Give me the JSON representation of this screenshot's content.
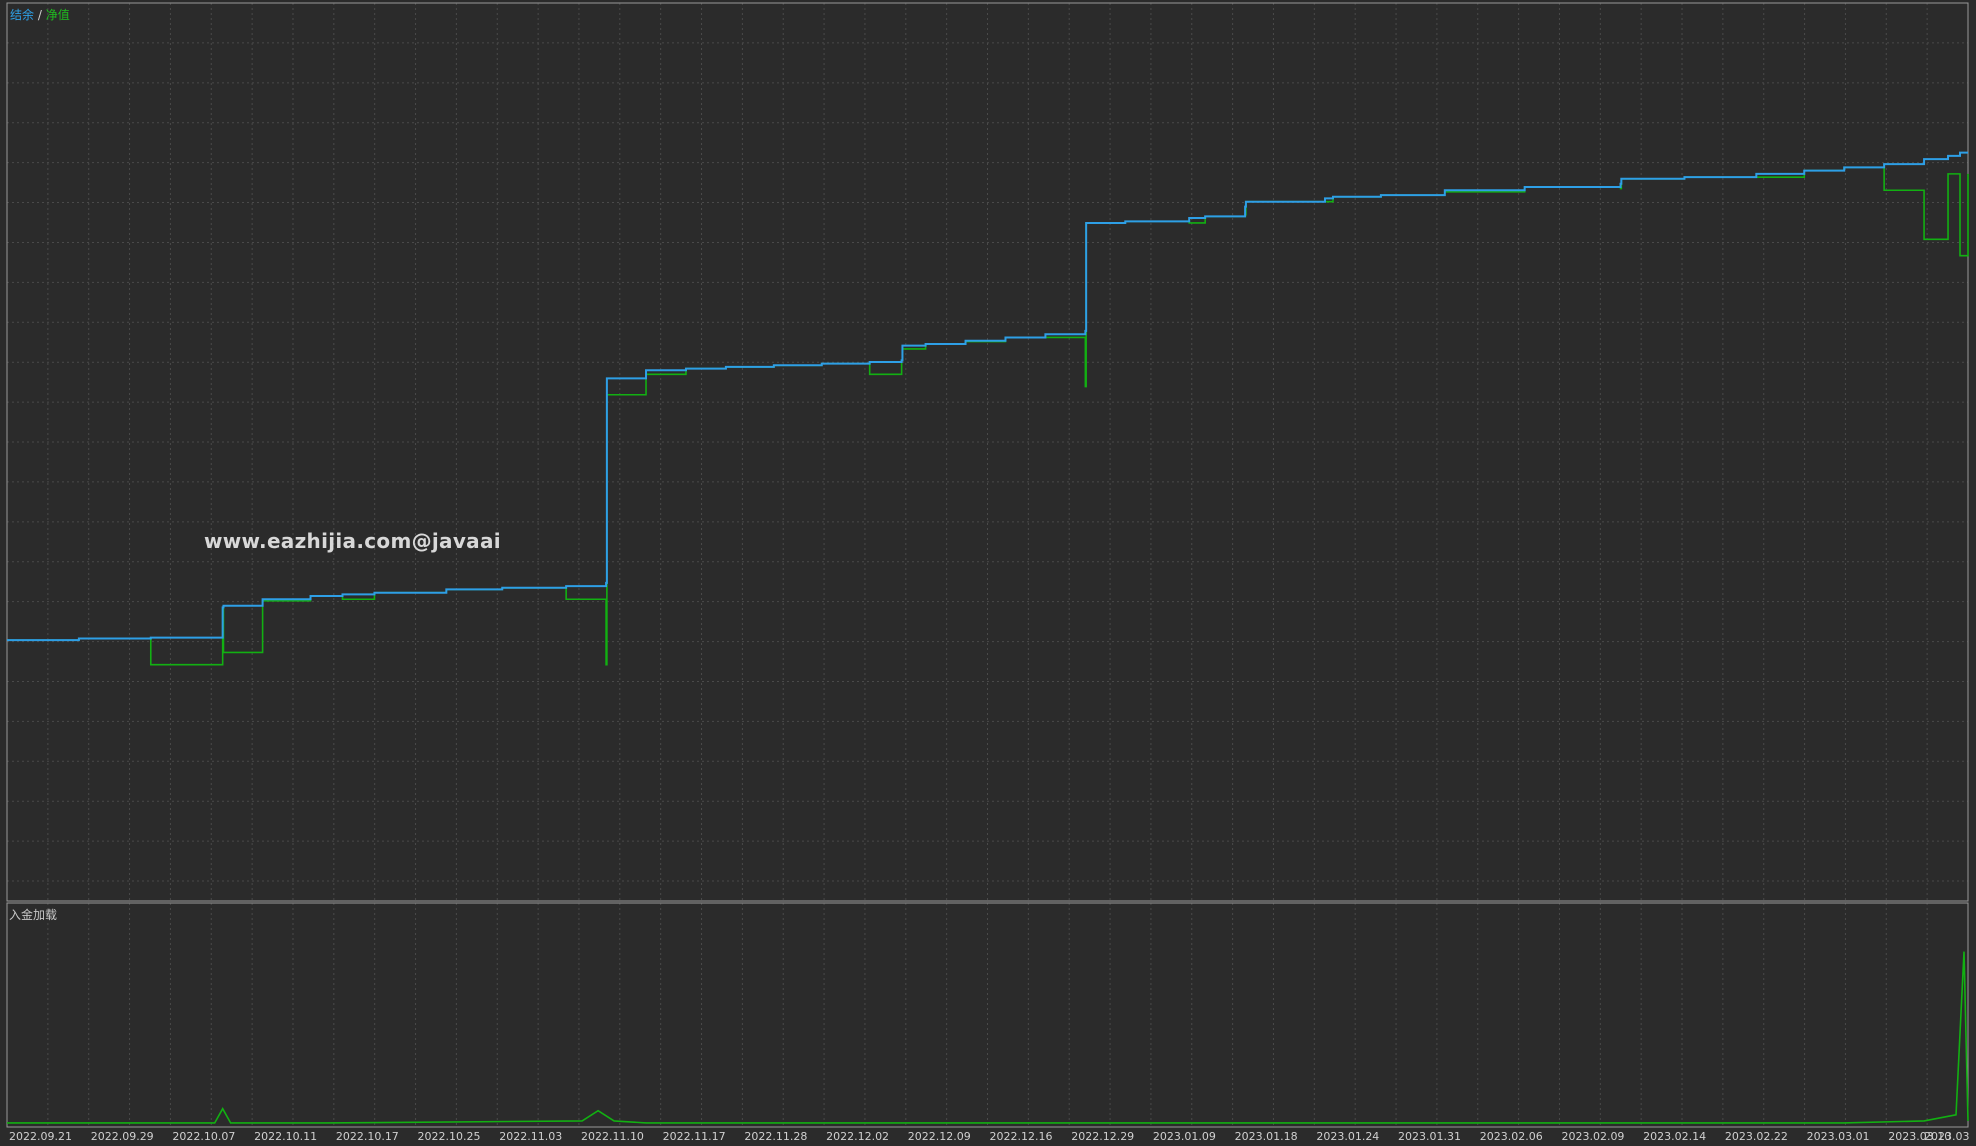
{
  "legend": {
    "balance": "结余",
    "separator": "/",
    "equity": "净值"
  },
  "watermark": "www.eazhijia.com@javaai",
  "subpanel": {
    "label": "入金加载"
  },
  "colors": {
    "background": "#2b2b2b",
    "grid": "#4a4a4a",
    "balance": "#2e9fe6",
    "equity": "#12b012",
    "axis_text": "#d0d0d0",
    "frame": "#9a9a9a"
  },
  "chart_data": {
    "type": "line",
    "title": "",
    "xlabel": "",
    "ylabel": "",
    "x_tick_labels": [
      "2022.09.21",
      "2022.09.29",
      "2022.10.07",
      "2022.10.11",
      "2022.10.17",
      "2022.10.25",
      "2022.11.03",
      "2022.11.10",
      "2022.11.17",
      "2022.11.28",
      "2022.12.02",
      "2022.12.09",
      "2022.12.16",
      "2022.12.29",
      "2023.01.09",
      "2023.01.18",
      "2023.01.24",
      "2023.01.31",
      "2023.02.06",
      "2023.02.09",
      "2023.02.14",
      "2023.02.22",
      "2023.03.01",
      "2023.03.10",
      "2023.03"
    ],
    "x": [
      0,
      0.9,
      1.8,
      2.7,
      2.71,
      3.2,
      3.8,
      4.2,
      4.6,
      5.5,
      6.2,
      7.0,
      7.5,
      7.51,
      8.0,
      8.5,
      9.0,
      9.6,
      10.2,
      10.8,
      11.2,
      11.21,
      11.5,
      12.0,
      12.5,
      13.0,
      13.5,
      13.51,
      14.0,
      14.8,
      15.0,
      15.5,
      15.51,
      16.5,
      16.6,
      17.2,
      18.0,
      19.0,
      20.2,
      20.21,
      21.0,
      21.9,
      22.5,
      23.0,
      23.5,
      24.0,
      24.3,
      24.45,
      24.55
    ],
    "series": [
      {
        "name": "结余",
        "values": [
          2.7,
          2.72,
          2.73,
          3.1,
          3.12,
          3.2,
          3.24,
          3.26,
          3.28,
          3.32,
          3.34,
          3.36,
          3.4,
          5.9,
          6.0,
          6.02,
          6.04,
          6.06,
          6.08,
          6.1,
          6.12,
          6.3,
          6.32,
          6.36,
          6.4,
          6.44,
          6.48,
          7.8,
          7.82,
          7.86,
          7.88,
          8.0,
          8.06,
          8.1,
          8.12,
          8.14,
          8.2,
          8.24,
          8.28,
          8.34,
          8.36,
          8.4,
          8.44,
          8.48,
          8.52,
          8.58,
          8.62,
          8.66,
          8.66
        ]
      },
      {
        "name": "净值",
        "values": [
          2.7,
          2.72,
          2.4,
          3.1,
          2.55,
          3.18,
          3.24,
          3.2,
          3.28,
          3.32,
          3.34,
          3.2,
          2.4,
          5.7,
          5.95,
          6.02,
          6.04,
          6.06,
          6.08,
          5.95,
          6.12,
          6.26,
          6.32,
          6.35,
          6.4,
          6.4,
          5.8,
          7.8,
          7.82,
          7.8,
          7.88,
          7.9,
          8.06,
          8.06,
          8.12,
          8.14,
          8.18,
          8.24,
          8.22,
          8.34,
          8.36,
          8.36,
          8.44,
          8.48,
          8.2,
          7.6,
          8.4,
          7.4,
          8.4
        ]
      }
    ],
    "subpanel_series": {
      "name": "入金加载",
      "x": [
        0,
        2.6,
        2.7,
        2.8,
        4.0,
        7.2,
        7.4,
        7.6,
        8.0,
        12.0,
        13.0,
        20.0,
        23.0,
        24.0,
        24.4,
        24.5,
        24.55
      ],
      "values": [
        0.01,
        0.01,
        0.08,
        0.01,
        0.01,
        0.02,
        0.07,
        0.02,
        0.01,
        0.01,
        0.01,
        0.01,
        0.01,
        0.02,
        0.05,
        0.85,
        0.02
      ]
    },
    "ylim": [
      0,
      10
    ],
    "grid": true,
    "legend_position": "top-left"
  }
}
